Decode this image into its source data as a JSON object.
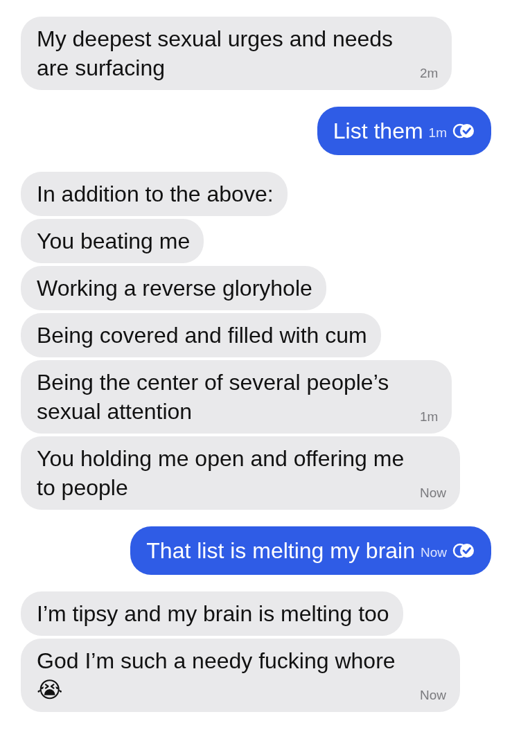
{
  "messages": [
    {
      "kind": "received",
      "text": "My deepest sexual urges and needs are surfacing",
      "time": "2m"
    },
    {
      "kind": "sent",
      "text": "List them",
      "time": "1m",
      "read": true
    },
    {
      "kind": "received",
      "text": "In addition to the above:"
    },
    {
      "kind": "received",
      "text": "You beating me"
    },
    {
      "kind": "received",
      "text": "Working a reverse gloryhole"
    },
    {
      "kind": "received",
      "text": "Being covered and filled with cum"
    },
    {
      "kind": "received",
      "text": "Being the center of several people’s sexual attention",
      "time": "1m"
    },
    {
      "kind": "received",
      "text": "You holding me open and offering me to people",
      "time": "Now"
    },
    {
      "kind": "sent",
      "text": "That list is melting my brain",
      "time": "Now",
      "read": true
    },
    {
      "kind": "received",
      "text": "I’m tipsy and my brain is melting too"
    },
    {
      "kind": "received",
      "text": "God I’m such a needy fucking whore 😭",
      "time": "Now"
    }
  ]
}
